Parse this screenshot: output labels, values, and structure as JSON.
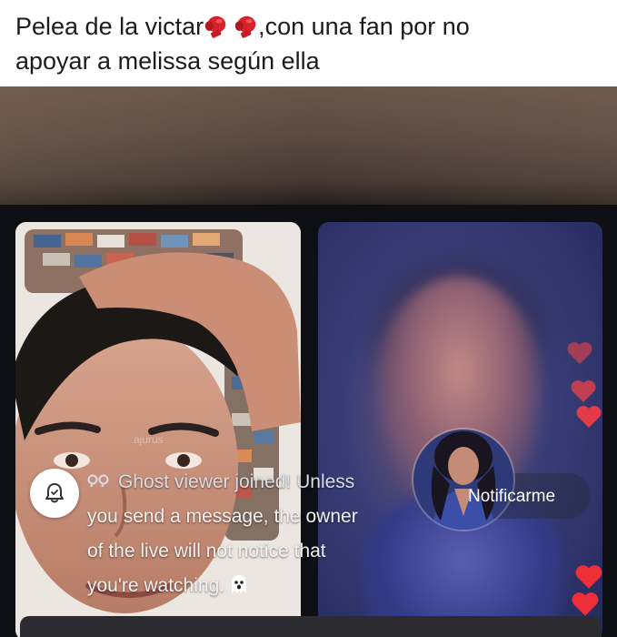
{
  "caption": {
    "line1_prefix": "Pelea de la victar",
    "line1_suffix": ",con una fan por no",
    "line2": "apoyar a melissa según ella",
    "emoji_icons": [
      "boxing-glove-icon",
      "boxing-glove-icon"
    ]
  },
  "live": {
    "notification": {
      "line1": "Ghost viewer joined! Unless",
      "line2": "you send a message, the owner",
      "line3": "of the live will not notice that",
      "line4": "you're watching. ",
      "quote_icon": "quote-icon",
      "ghost_icon": "ghost-icon"
    },
    "notify_button_label": "Notificarme",
    "bell_icon": "bell-icon",
    "hearts_count_visible": 5,
    "colors": {
      "heart": "#e8303c",
      "glove": "#d8212b"
    }
  }
}
